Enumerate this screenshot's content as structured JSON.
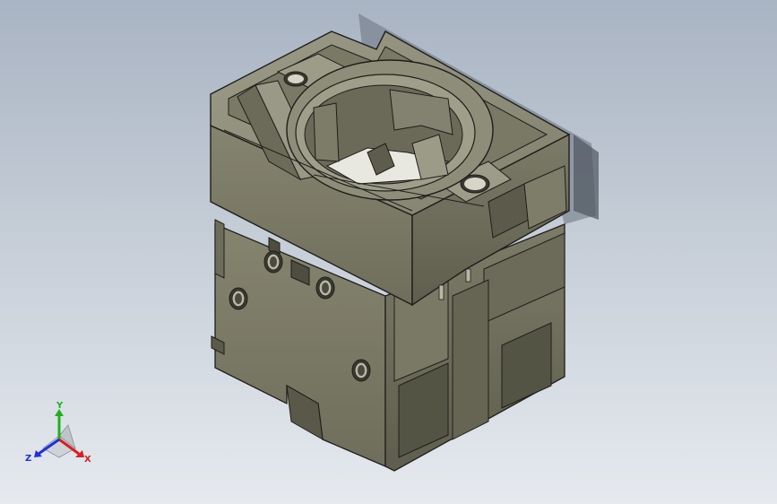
{
  "viewport": {
    "background_top": "#a9b4c3",
    "background_bottom": "#e6eaef"
  },
  "model": {
    "face_color": "#8d8c7a",
    "edge_color": "#1e1e1a"
  },
  "triad": {
    "x_label": "X",
    "y_label": "Y",
    "z_label": "Z",
    "x_color": "#d62020",
    "y_color": "#1fb01f",
    "z_color": "#2030d8"
  }
}
